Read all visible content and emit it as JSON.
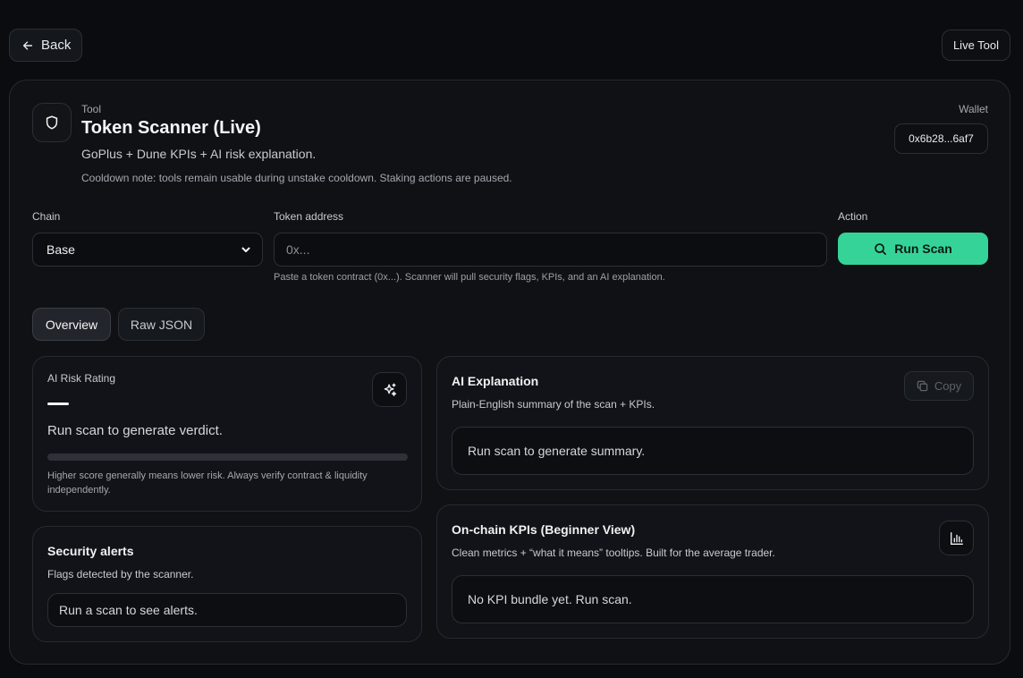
{
  "header": {
    "back_label": "Back",
    "live_badge": "Live Tool"
  },
  "tool": {
    "label": "Tool",
    "title": "Token Scanner (Live)",
    "subtitle": "GoPlus + Dune KPIs + AI risk explanation.",
    "cooldown_note": "Cooldown note: tools remain usable during unstake cooldown. Staking actions are paused.",
    "icon": "shield-icon"
  },
  "wallet": {
    "label": "Wallet",
    "address": "0x6b28...6af7"
  },
  "form": {
    "chain_label": "Chain",
    "chain_value": "Base",
    "token_label": "Token address",
    "token_placeholder": "0x...",
    "token_value": "",
    "hint": "Paste a token contract (0x...). Scanner will pull security flags, KPIs, and an AI explanation.",
    "action_label": "Action",
    "run_label": "Run Scan"
  },
  "tabs": [
    {
      "label": "Overview",
      "active": true
    },
    {
      "label": "Raw JSON",
      "active": false
    }
  ],
  "risk": {
    "label": "AI Risk Rating",
    "score_display": "—",
    "verdict": "Run scan to generate verdict.",
    "score_fraction": 0,
    "note": "Higher score generally means lower risk. Always verify contract & liquidity independently.",
    "icon": "sparkles-icon"
  },
  "alerts": {
    "title": "Security alerts",
    "desc": "Flags detected by the scanner.",
    "empty": "Run a scan to see alerts."
  },
  "explanation": {
    "title": "AI Explanation",
    "desc": "Plain-English summary of the scan + KPIs.",
    "copy_label": "Copy",
    "empty": "Run scan to generate summary."
  },
  "kpis": {
    "title": "On-chain KPIs (Beginner View)",
    "desc": "Clean metrics + “what it means” tooltips. Built for the average trader.",
    "empty": "No KPI bundle yet. Run scan.",
    "icon": "bar-chart-icon"
  },
  "colors": {
    "accent": "#36d399",
    "background": "#0a0c0f",
    "card": "#0f1115"
  }
}
